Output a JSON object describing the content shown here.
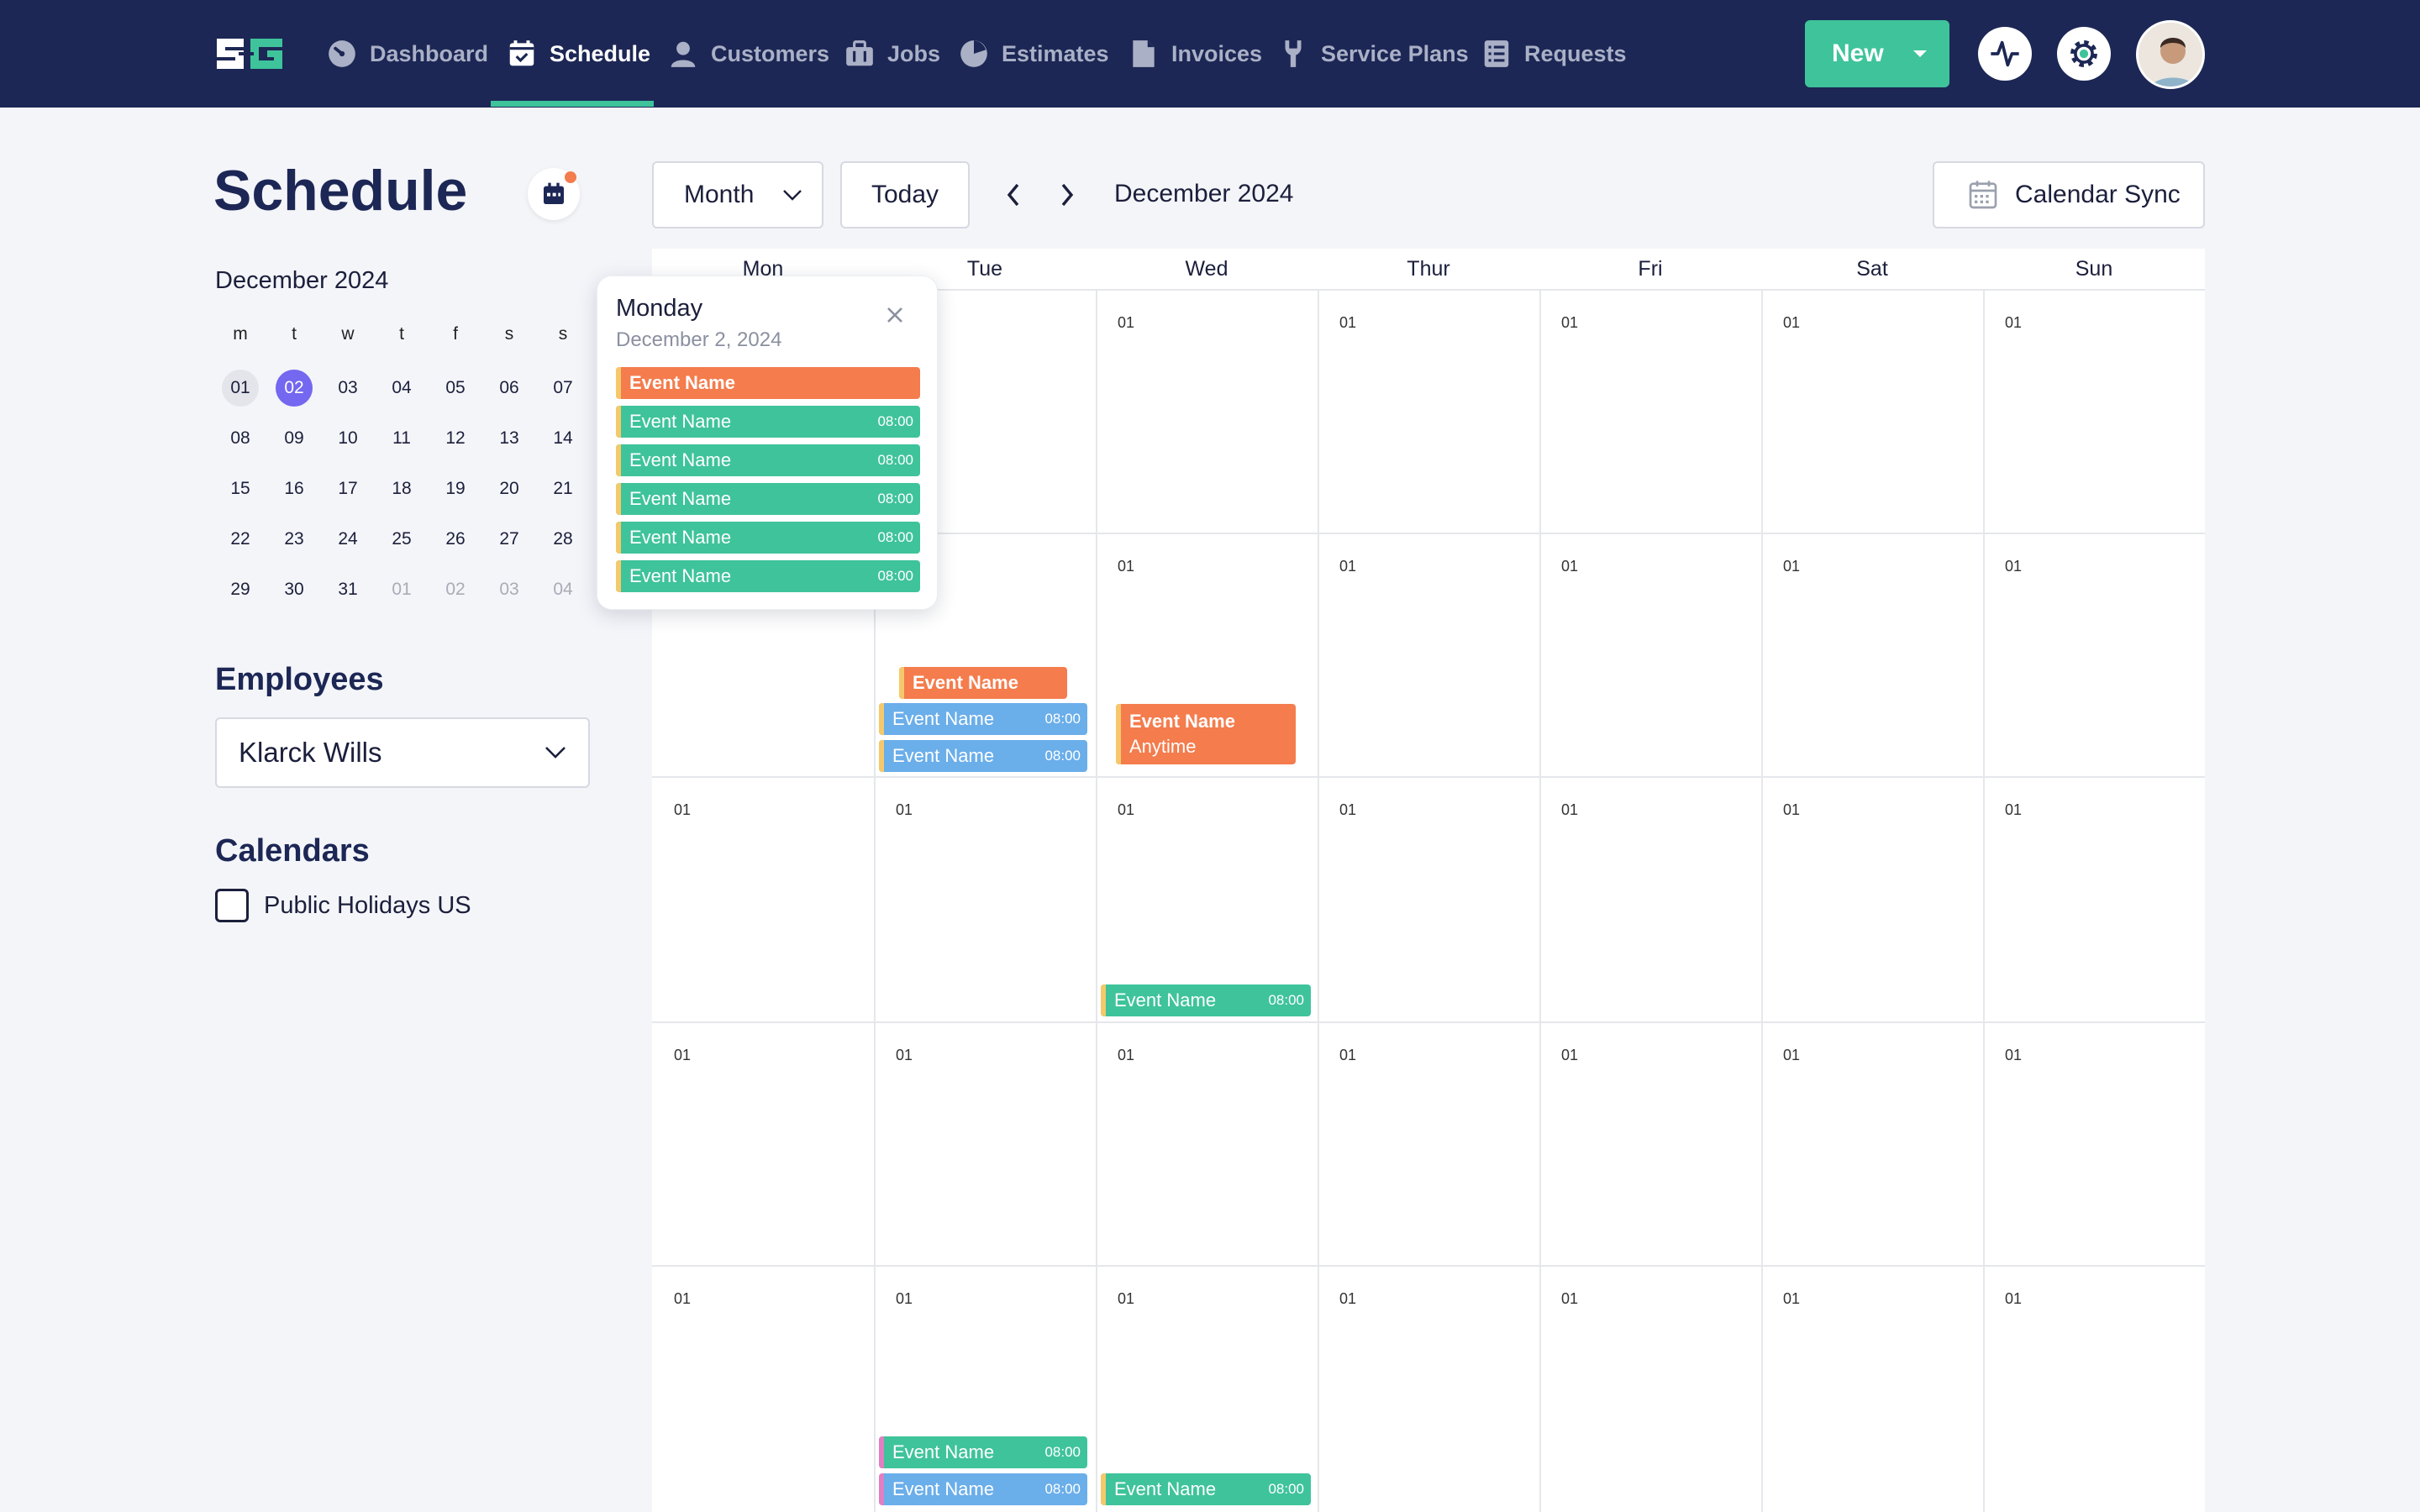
{
  "nav": {
    "items": [
      {
        "label": "Dashboard",
        "icon": "gauge-icon"
      },
      {
        "label": "Schedule",
        "icon": "calendar-check-icon",
        "active": true
      },
      {
        "label": "Customers",
        "icon": "user-icon"
      },
      {
        "label": "Jobs",
        "icon": "briefcase-icon"
      },
      {
        "label": "Estimates",
        "icon": "pie-icon"
      },
      {
        "label": "Invoices",
        "icon": "document-icon"
      },
      {
        "label": "Service Plans",
        "icon": "wrench-icon"
      },
      {
        "label": "Requests",
        "icon": "list-icon"
      }
    ],
    "new_label": "New"
  },
  "page": {
    "title": "Schedule"
  },
  "mini_calendar": {
    "title": "December 2024",
    "dow": [
      "m",
      "t",
      "w",
      "t",
      "f",
      "s",
      "s"
    ],
    "weeks": [
      [
        "01",
        "02",
        "03",
        "04",
        "05",
        "06",
        "07"
      ],
      [
        "08",
        "09",
        "10",
        "11",
        "12",
        "13",
        "14"
      ],
      [
        "15",
        "16",
        "17",
        "18",
        "19",
        "20",
        "21"
      ],
      [
        "22",
        "23",
        "24",
        "25",
        "26",
        "27",
        "28"
      ],
      [
        "29",
        "30",
        "31",
        "01",
        "02",
        "03",
        "04"
      ]
    ]
  },
  "employees": {
    "heading": "Employees",
    "selected": "Klarck Wills"
  },
  "calendars": {
    "heading": "Calendars",
    "items": [
      {
        "label": "Public Holidays US",
        "checked": false
      }
    ]
  },
  "toolbar": {
    "view": "Month",
    "today": "Today",
    "current": "December 2024",
    "sync": "Calendar Sync"
  },
  "grid": {
    "days": [
      "Mon",
      "Tue",
      "Wed",
      "Thur",
      "Fri",
      "Sat",
      "Sun"
    ],
    "day_label": "01"
  },
  "events": {
    "name": "Event Name",
    "time": "08:00",
    "anytime": "Anytime"
  },
  "popover": {
    "day": "Monday",
    "date": "December 2, 2024"
  },
  "colors": {
    "nav_bg": "#1c2755",
    "accent": "#3fc39b",
    "orange": "#f47c4d",
    "blue": "#6aaeea",
    "selected_day": "#7467f0"
  }
}
